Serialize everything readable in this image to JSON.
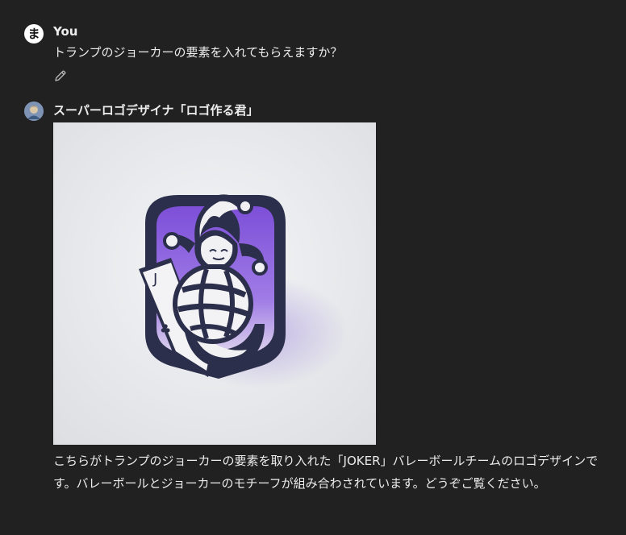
{
  "user_message": {
    "avatar_letter": "ま",
    "sender": "You",
    "text": "トランプのジョーカーの要素を入れてもらえますか？",
    "edit_icon": "pencil-icon"
  },
  "assistant_message": {
    "sender": "スーパーロゴデザイナ「ロゴ作る君」",
    "image": {
      "card_letter": "J",
      "card_suit": "♣"
    },
    "text": "こちらがトランプのジョーカーの要素を取り入れた「JOKER」バレーボールチームのロゴデザインです。バレーボールとジョーカーのモチーフが組み合わされています。どうぞご覧ください。"
  },
  "colors": {
    "background": "#212121",
    "text": "#ececec",
    "logo_navy": "#2c2f4b",
    "logo_purple": "#8d5fe0"
  }
}
